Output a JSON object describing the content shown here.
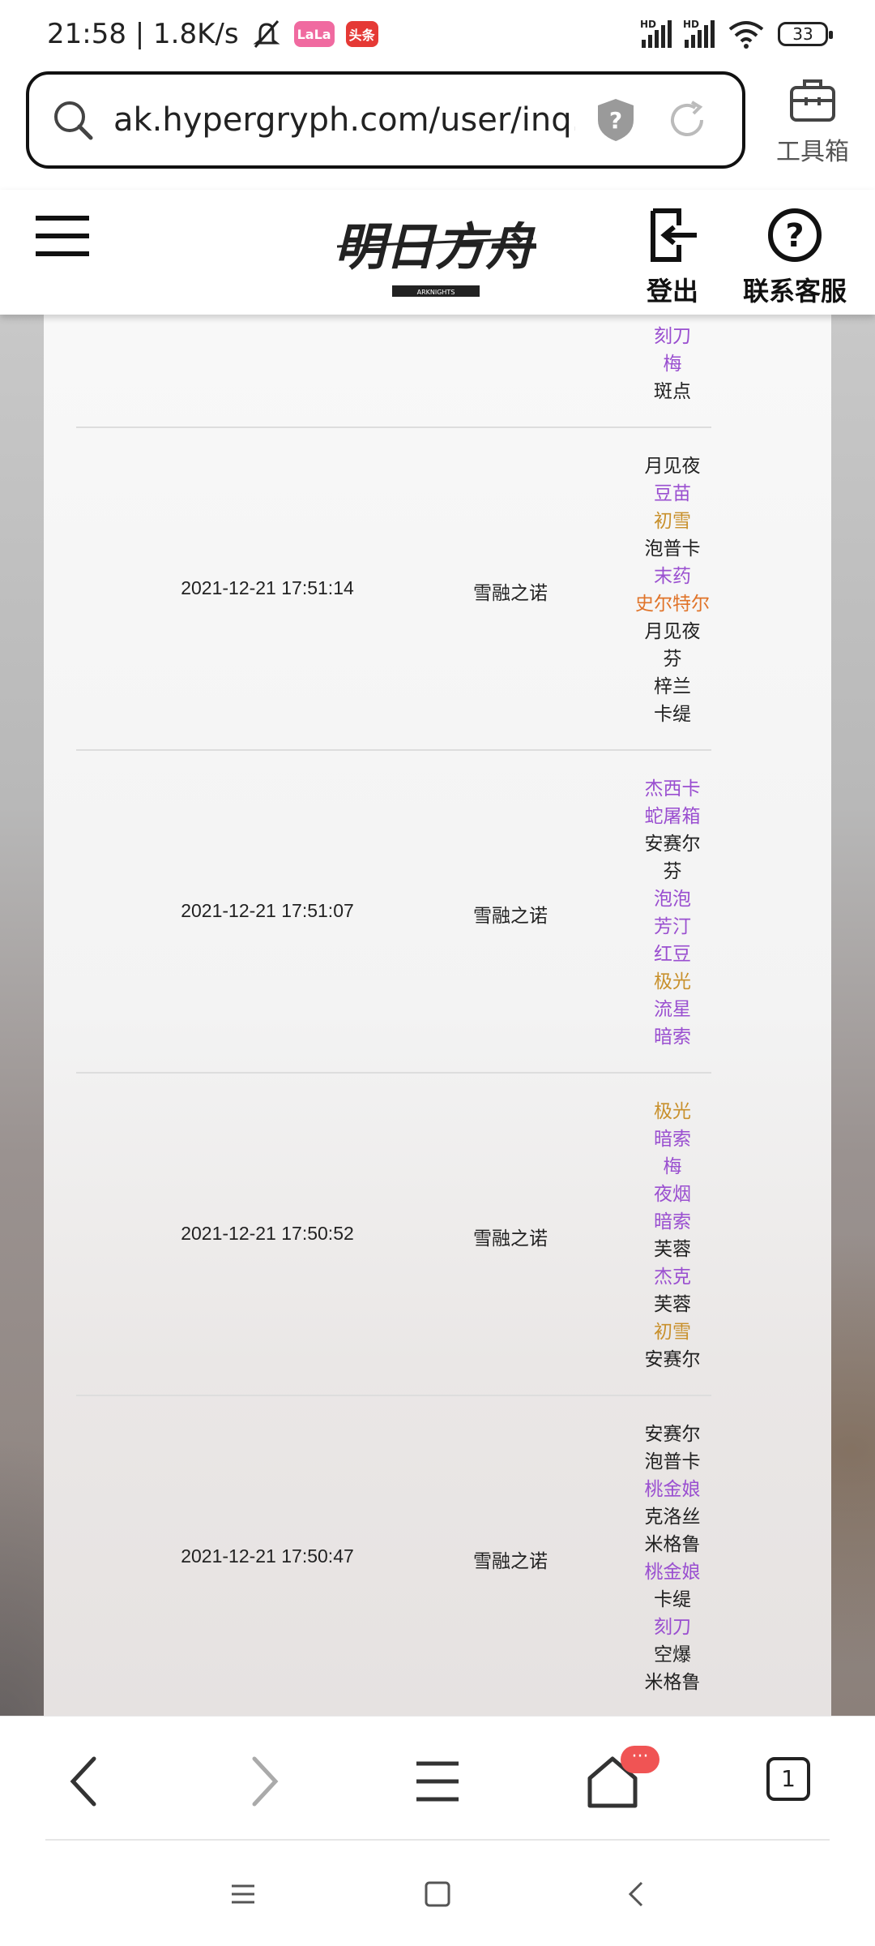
{
  "status_bar": {
    "time_speed": "21:58 | 1.8K/s",
    "badge_app": "LaLa",
    "badge_news": "头条",
    "signal_hd": "HD",
    "battery": "33"
  },
  "url_bar": {
    "url": "ak.hypergryph.com/user/inq...",
    "toolbox_label": "工具箱"
  },
  "site_header": {
    "logo_text": "明日方舟",
    "logo_sub": "ARKNIGHTS",
    "logout_label": "登出",
    "contact_label": "联系客服"
  },
  "colors": {
    "rarity_4": "#9a4fd0",
    "rarity_5": "#c8902c",
    "rarity_6": "#e0742a",
    "rarity_3": "#222222"
  },
  "records": [
    {
      "time": "",
      "pool": "",
      "operators": [
        {
          "name": "刻刀",
          "rarity": 4
        },
        {
          "name": "梅",
          "rarity": 4
        },
        {
          "name": "斑点",
          "rarity": 3
        }
      ]
    },
    {
      "time": "2021-12-21 17:51:14",
      "pool": "雪融之诺",
      "operators": [
        {
          "name": "月见夜",
          "rarity": 3
        },
        {
          "name": "豆苗",
          "rarity": 4
        },
        {
          "name": "初雪",
          "rarity": 5
        },
        {
          "name": "泡普卡",
          "rarity": 3
        },
        {
          "name": "末药",
          "rarity": 4
        },
        {
          "name": "史尔特尔",
          "rarity": 6
        },
        {
          "name": "月见夜",
          "rarity": 3
        },
        {
          "name": "芬",
          "rarity": 3
        },
        {
          "name": "梓兰",
          "rarity": 3
        },
        {
          "name": "卡缇",
          "rarity": 3
        }
      ]
    },
    {
      "time": "2021-12-21 17:51:07",
      "pool": "雪融之诺",
      "operators": [
        {
          "name": "杰西卡",
          "rarity": 4
        },
        {
          "name": "蛇屠箱",
          "rarity": 4
        },
        {
          "name": "安赛尔",
          "rarity": 3
        },
        {
          "name": "芬",
          "rarity": 3
        },
        {
          "name": "泡泡",
          "rarity": 4
        },
        {
          "name": "芳汀",
          "rarity": 4
        },
        {
          "name": "红豆",
          "rarity": 4
        },
        {
          "name": "极光",
          "rarity": 5
        },
        {
          "name": "流星",
          "rarity": 4
        },
        {
          "name": "暗索",
          "rarity": 4
        }
      ]
    },
    {
      "time": "2021-12-21 17:50:52",
      "pool": "雪融之诺",
      "operators": [
        {
          "name": "极光",
          "rarity": 5
        },
        {
          "name": "暗索",
          "rarity": 4
        },
        {
          "name": "梅",
          "rarity": 4
        },
        {
          "name": "夜烟",
          "rarity": 4
        },
        {
          "name": "暗索",
          "rarity": 4
        },
        {
          "name": "芙蓉",
          "rarity": 3
        },
        {
          "name": "杰克",
          "rarity": 4
        },
        {
          "name": "芙蓉",
          "rarity": 3
        },
        {
          "name": "初雪",
          "rarity": 5
        },
        {
          "name": "安赛尔",
          "rarity": 3
        }
      ]
    },
    {
      "time": "2021-12-21 17:50:47",
      "pool": "雪融之诺",
      "operators": [
        {
          "name": "安赛尔",
          "rarity": 3
        },
        {
          "name": "泡普卡",
          "rarity": 3
        },
        {
          "name": "桃金娘",
          "rarity": 4
        },
        {
          "name": "克洛丝",
          "rarity": 3
        },
        {
          "name": "米格鲁",
          "rarity": 3
        },
        {
          "name": "桃金娘",
          "rarity": 4
        },
        {
          "name": "卡缇",
          "rarity": 3
        },
        {
          "name": "刻刀",
          "rarity": 4
        },
        {
          "name": "空爆",
          "rarity": 3
        },
        {
          "name": "米格鲁",
          "rarity": 3
        }
      ]
    }
  ],
  "bottom_nav": {
    "home_badge": "···",
    "tab_count": "1"
  }
}
